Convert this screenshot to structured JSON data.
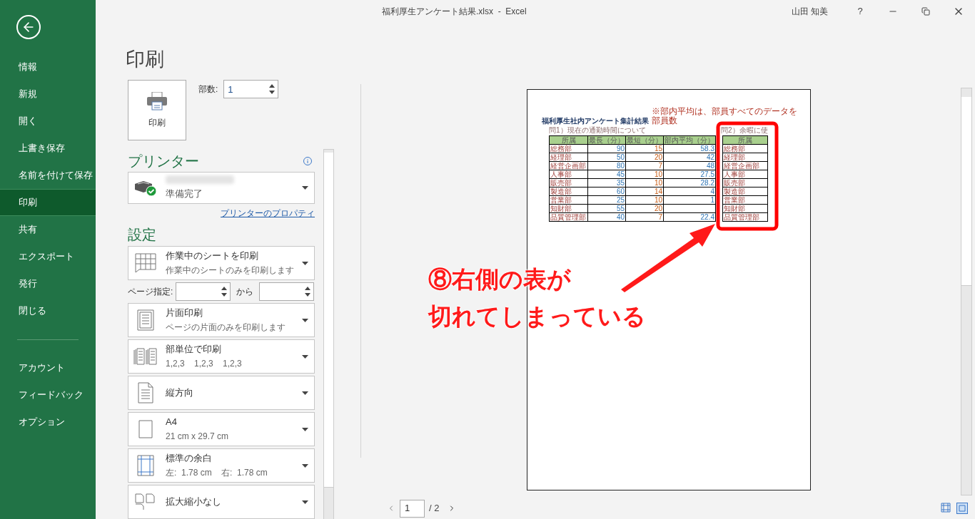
{
  "title_bar": {
    "title": "福利厚生アンケート結果.xlsx  -  Excel",
    "user": "山田 知美",
    "help": "?"
  },
  "sidebar": {
    "items": [
      {
        "label": "情報",
        "selected": false
      },
      {
        "label": "新規",
        "selected": false
      },
      {
        "label": "開く",
        "selected": false
      },
      {
        "label": "上書き保存",
        "selected": false
      },
      {
        "label": "名前を付けて保存",
        "selected": false
      },
      {
        "label": "印刷",
        "selected": true
      },
      {
        "label": "共有",
        "selected": false
      },
      {
        "label": "エクスポート",
        "selected": false
      },
      {
        "label": "発行",
        "selected": false
      },
      {
        "label": "閉じる",
        "selected": false
      }
    ],
    "footer_items": [
      {
        "label": "アカウント",
        "selected": false
      },
      {
        "label": "フィードバック",
        "selected": false
      },
      {
        "label": "オプション",
        "selected": false
      }
    ]
  },
  "heading": "印刷",
  "print_button": {
    "label": "印刷"
  },
  "copies": {
    "label": "部数:",
    "value": "1"
  },
  "printer": {
    "heading": "プリンター",
    "status": "準備完了",
    "properties_link": "プリンターのプロパティ"
  },
  "settings": {
    "heading": "設定",
    "items": [
      {
        "kind": "dropdown",
        "title": "作業中のシートを印刷",
        "subtitle": "作業中のシートのみを印刷します"
      },
      {
        "kind": "page_range",
        "label": "ページ指定:",
        "to_label": "から"
      },
      {
        "kind": "dropdown",
        "title": "片面印刷",
        "subtitle": "ページの片面のみを印刷します"
      },
      {
        "kind": "dropdown",
        "title": "部単位で印刷",
        "subtitle": "1,2,3    1,2,3    1,2,3"
      },
      {
        "kind": "dropdown",
        "title": "縦方向"
      },
      {
        "kind": "dropdown",
        "title": "A4",
        "subtitle": "21 cm x 29.7 cm"
      },
      {
        "kind": "dropdown",
        "title": "標準の余白",
        "subtitle": "左:  1.78 cm    右:  1.78 cm"
      },
      {
        "kind": "dropdown",
        "title": "拡大縮小なし"
      }
    ]
  },
  "preview": {
    "title": "福利厚生社内アンケート集計結果",
    "note": "※部内平均は、部員すべてのデータを部員数",
    "table1": {
      "caption": "問1）現在の通勤時間について",
      "columns": [
        "所属",
        "最長（分）",
        "最短（分）",
        "部内平均（分）"
      ],
      "rows": [
        [
          "総務部",
          "90",
          "15",
          "58.3"
        ],
        [
          "経理部",
          "50",
          "20",
          "42"
        ],
        [
          "経営企画部",
          "80",
          "7",
          "48"
        ],
        [
          "人事部",
          "45",
          "10",
          "27.5"
        ],
        [
          "販売部",
          "35",
          "10",
          "28.2"
        ],
        [
          "製造部",
          "60",
          "14",
          "4"
        ],
        [
          "営業部",
          "25",
          "10",
          "1"
        ],
        [
          "知財部",
          "55",
          "20",
          null
        ],
        [
          "品質管理部",
          "40",
          "7",
          "22.4"
        ]
      ]
    },
    "table2": {
      "caption": "問2）余暇に使",
      "column": "所属",
      "rows": [
        "総務部",
        "経理部",
        "経営企画部",
        "人事部",
        "販売部",
        "製造部",
        "営業部",
        "知財部",
        "品質管理部"
      ]
    }
  },
  "annotation": {
    "lines": [
      "⑧右側の表が",
      "切れてしまっている"
    ]
  },
  "pager": {
    "page": "1",
    "total": "/ 2"
  }
}
